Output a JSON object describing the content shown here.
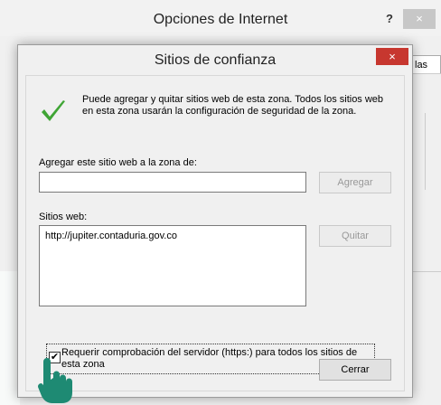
{
  "background_window": {
    "title": "Opciones de Internet",
    "help_label": "?",
    "close_label": "×",
    "tab_fragment": "las"
  },
  "dialog": {
    "title": "Sitios de confianza",
    "close_label": "×",
    "intro_text": "Puede agregar y quitar sitios web de esta zona. Todos los sitios web en esta zona usarán la configuración de seguridad de la zona.",
    "add_label": "Agregar este sitio web a la zona de:",
    "add_input_value": "",
    "add_button": "Agregar",
    "websites_label": "Sitios web:",
    "websites": [
      "http://jupiter.contaduria.gov.co"
    ],
    "remove_button": "Quitar",
    "https_checkbox": {
      "checked": true,
      "label": "Requerir comprobación del servidor (https:) para todos los sitios de esta zona"
    },
    "close_button": "Cerrar"
  },
  "colors": {
    "dialog_close_bg": "#c7372f",
    "check_green": "#3fa535",
    "cursor_teal": "#1e8a73"
  },
  "icons": {
    "check": "green-check-icon",
    "cursor": "hand-pointer-icon"
  }
}
